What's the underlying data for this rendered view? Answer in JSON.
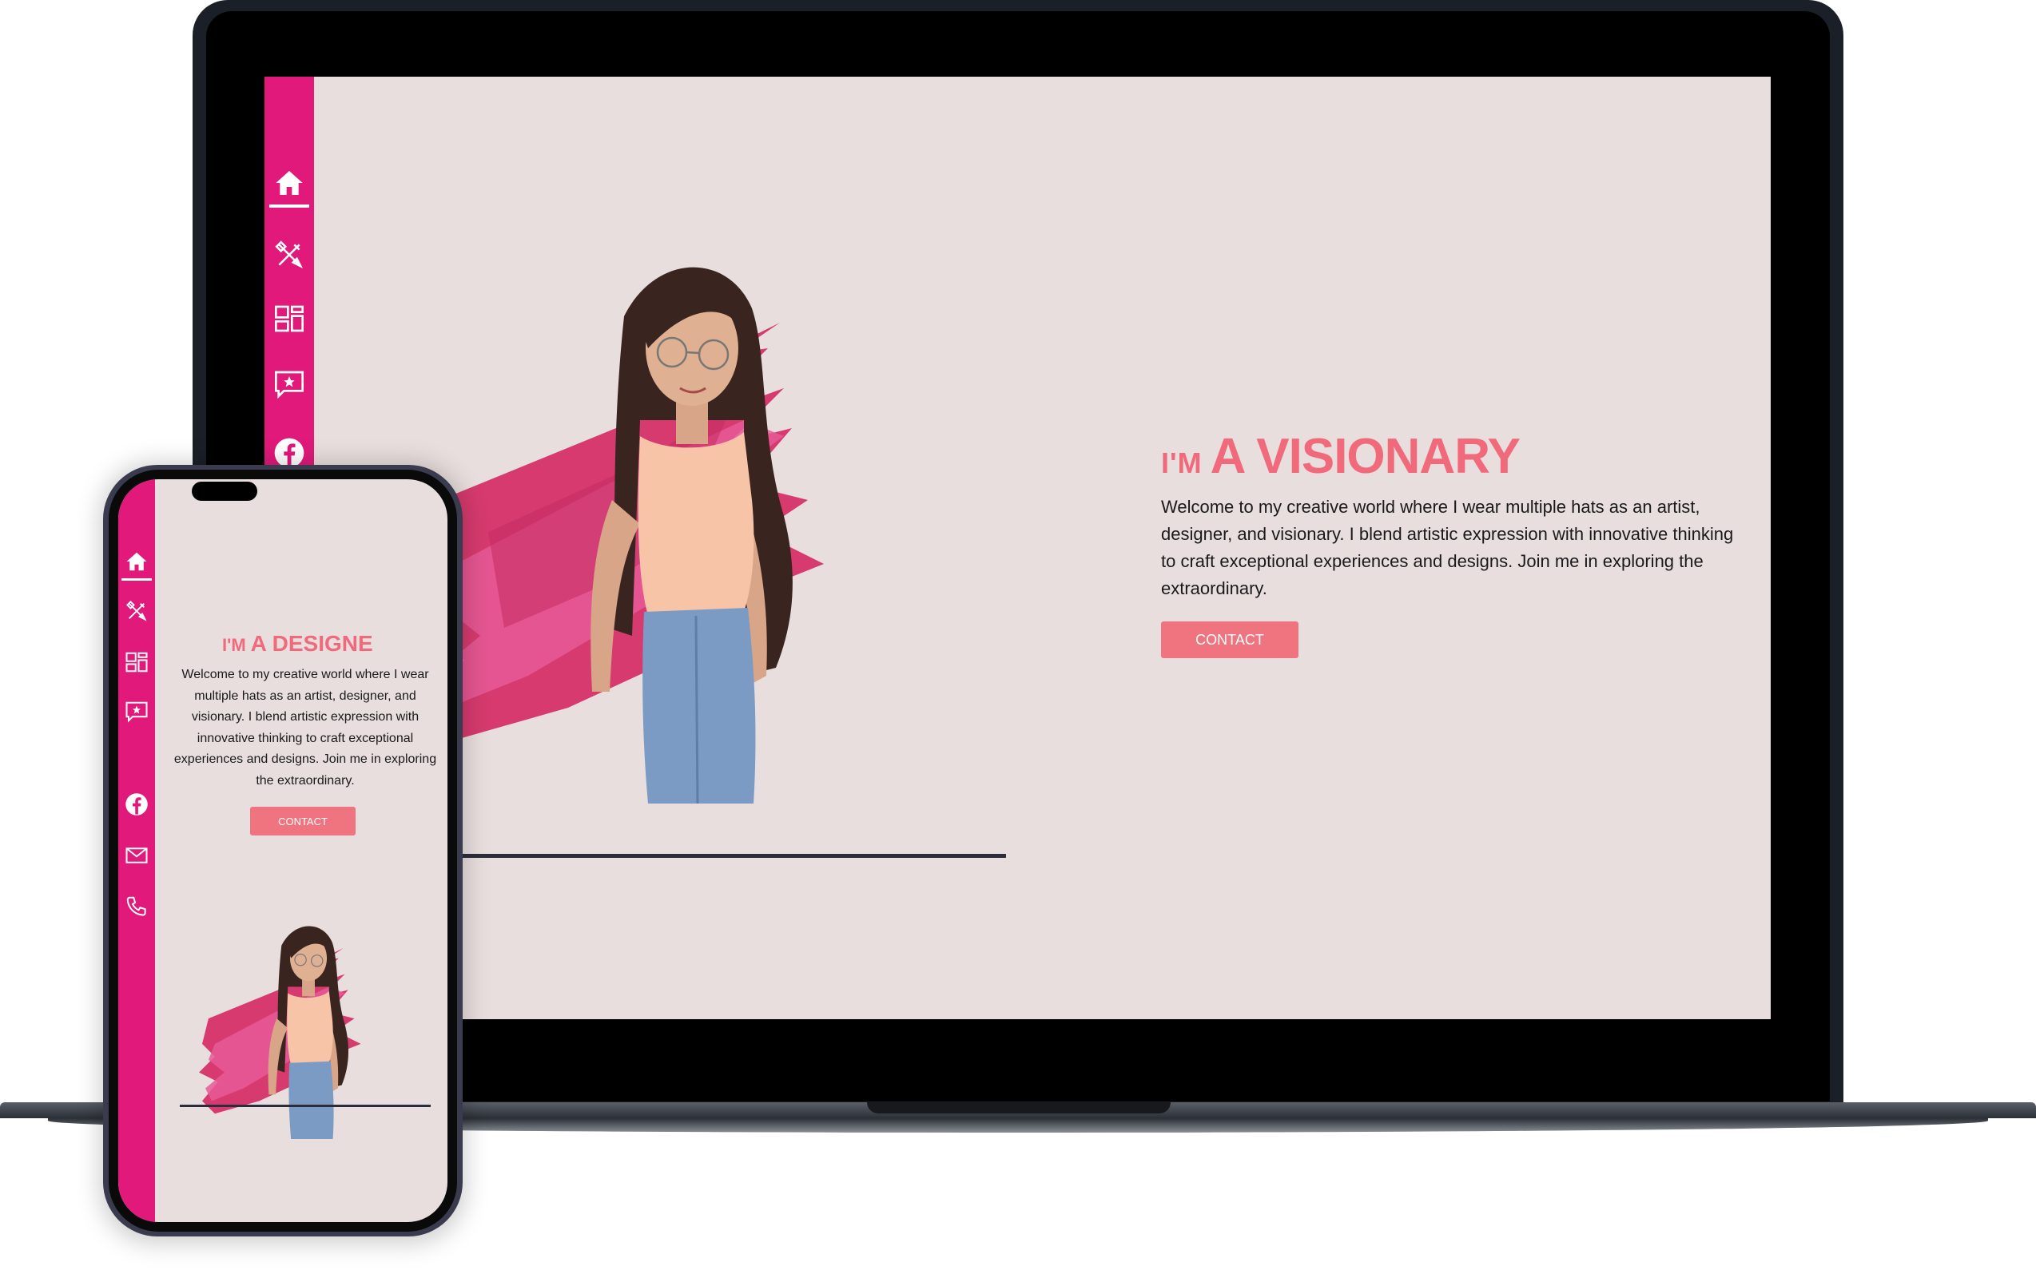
{
  "laptop": {
    "hero": {
      "title_prefix": "I'M",
      "title_main": "A VISIONARY",
      "body": "Welcome to my creative world where I wear multiple hats as an artist, designer, and visionary. I blend artistic expression with innovative thinking to craft exceptional experiences and designs. Join me in exploring the extraordinary.",
      "contact_label": "CONTACT"
    },
    "sidebar_icons": [
      "home-icon",
      "design-tools-icon",
      "portfolio-grid-icon",
      "testimonial-icon",
      "facebook-icon"
    ]
  },
  "phone": {
    "hero": {
      "title_prefix": "I'M",
      "title_main": "A DESIGNE",
      "body": "Welcome to my creative world where I wear multiple hats as an artist, designer, and visionary. I blend artistic expression with innovative thinking to craft exceptional experiences and designs. Join me in exploring the extraordinary.",
      "contact_label": "CONTACT"
    },
    "sidebar_icons": [
      "home-icon",
      "design-tools-icon",
      "portfolio-grid-icon",
      "testimonial-icon",
      "facebook-icon",
      "mail-icon",
      "phone-icon"
    ]
  },
  "colors": {
    "accent_pink": "#e0197a",
    "title_coral": "#f06a7b",
    "button_coral": "#f07380",
    "background": "#e8dedd",
    "device_dark": "#1b1f27"
  }
}
